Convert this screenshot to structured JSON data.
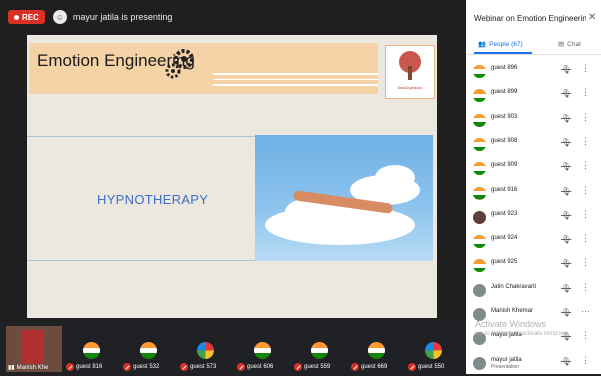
{
  "topbar": {
    "rec_label": "REC",
    "presenting_text": "mayur jatila is presenting"
  },
  "slide": {
    "title": "Emotion Engineering",
    "subtitle": "HYPNOTHERAPY",
    "logo_text": "SwaGyankuru"
  },
  "tiles": {
    "self_name": "Manish Khe",
    "guests": [
      {
        "name": "guest 816",
        "icon": "india-flag"
      },
      {
        "name": "guest 532",
        "icon": "india-flag"
      },
      {
        "name": "guest 573",
        "icon": "multicolor-logo"
      },
      {
        "name": "guest 606",
        "icon": "india-flag"
      },
      {
        "name": "guest 559",
        "icon": "india-flag"
      },
      {
        "name": "guest 669",
        "icon": "india-flag"
      },
      {
        "name": "guest 550",
        "icon": "multicolor-logo"
      }
    ]
  },
  "panel": {
    "title": "Webinar on Emotion Engineering...",
    "people_tab": "People (67)",
    "chat_tab": "Chat",
    "participants": [
      {
        "name": "guest 896",
        "sub": "",
        "more": "⋮"
      },
      {
        "name": "guest 899",
        "sub": "",
        "more": "⋮"
      },
      {
        "name": "guest 903",
        "sub": "",
        "more": "⋮"
      },
      {
        "name": "guest 908",
        "sub": "",
        "more": "⋮"
      },
      {
        "name": "guest 909",
        "sub": "",
        "more": "⋮"
      },
      {
        "name": "guest 916",
        "sub": "",
        "more": "⋮"
      },
      {
        "name": "guest 923",
        "sub": "",
        "more": "⋮"
      },
      {
        "name": "guest 924",
        "sub": "",
        "more": "⋮"
      },
      {
        "name": "guest 925",
        "sub": "",
        "more": "⋮"
      },
      {
        "name": "Jatin Chakravarti",
        "sub": "",
        "more": "⋮"
      },
      {
        "name": "Manish Khemar",
        "sub": "",
        "more": "···"
      },
      {
        "name": "mayur jatila",
        "sub": "",
        "more": "⋮"
      },
      {
        "name": "mayur jatila",
        "sub": "Presentation",
        "more": "⋮"
      }
    ],
    "watermark_title": "Activate Windows",
    "watermark_sub": "Go to Settings to activate Windows."
  },
  "colors": {
    "accent": "#1a73e8",
    "rec": "#d93025",
    "title_band": "#f6d2a7"
  }
}
